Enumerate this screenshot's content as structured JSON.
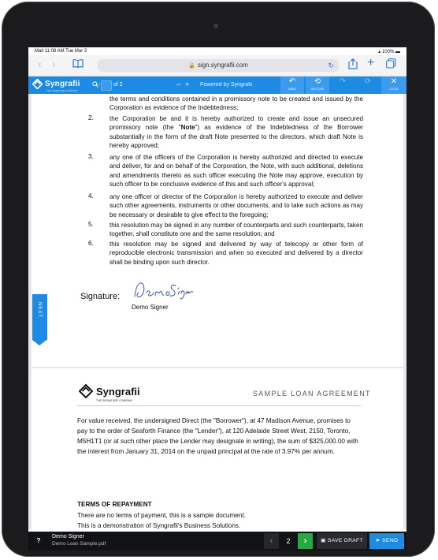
{
  "status_bar": {
    "left": "Mail  11:08 AM  Tue Mar 3",
    "right": "100%"
  },
  "browser": {
    "url": "sign.syngrafii.com"
  },
  "app_toolbar": {
    "brand": "Syngrafii",
    "brand_sub": "THE SIGNATURE COMPANY",
    "zoom_out": "−",
    "zoom_in": "+",
    "page_of": "of 2",
    "powered_by": "Powered by Syngrafii",
    "tools": [
      {
        "label": "UNDO"
      },
      {
        "label": "RESTORE"
      },
      {
        "label": ""
      },
      {
        "label": ""
      },
      {
        "label": "CLOSE"
      }
    ]
  },
  "page1": {
    "intro": "the terms and conditions contained in a promissory note to be created and issued by the Corporation as evidence of the Indebtedness;",
    "items": [
      {
        "num": "2.",
        "text": "the Corporation be and it is hereby authorized to create and issue an unsecured promissory note (the \"Note\") as evidence of the Indebtedness of the Borrower substantially in the form of the draft Note presented to the directors, which draft Note is hereby approved;"
      },
      {
        "num": "3.",
        "text": "any one of the officers of the Corporation is hereby authorized and directed to execute and deliver, for and on behalf of the Corporation, the Note, with such additional, deletions and amendments thereto as such officer executing the Note may approve, execution by such officer to be conclusive evidence of this and such officer's approval;"
      },
      {
        "num": "4.",
        "text": "any one officer or director of the Corporation is hereby authorized to execute and deliver such other agreements, instruments or other documents, and to take such actions as may be necessary or desirable to give effect to the foregoing;"
      },
      {
        "num": "5.",
        "text": "this resolution may be signed in any number of counterparts and such counterparts, taken together, shall constitute one and the same resolution; and"
      },
      {
        "num": "6.",
        "text": "this resolution may be signed and delivered by way of telecopy or other form of reproducible electronic transmission and when so executed and delivered by a director shall be binding upon such director."
      }
    ],
    "signature_label": "Signature:",
    "signature_script": "Demo Signer",
    "signer_name": "Demo Signer",
    "next_tab": "NEXT"
  },
  "page2": {
    "logo": "Syngrafii",
    "logo_sub": "THE SIGNATURE COMPANY",
    "title": "SAMPLE LOAN AGREEMENT",
    "paragraph": "For value received, the undersigned Direct (the \"Borrower\"), at 47 Madison Avenue, promises to pay to the order of Seaforth Finance (the \"Lender\"), at 120 Adelaide Street West, 2150, Toronto, M5H1T1 (or at such other place the Lender may designate in writing), the sum of $325,000.00 with the interest from January 31, 2014 on the unpaid principal at the rate of 3.97% per annum.",
    "heading": "TERMS OF REPAYMENT",
    "line1": "There are no terms of payment, this is a sample document.",
    "line2": "This is a demonstration of Syngrafii's Business Solutions."
  },
  "bottom_bar": {
    "help": "?",
    "signer": "Demo Signer",
    "file": "Demo Loan Sample.pdf",
    "prev": "‹",
    "page": "2",
    "next": "›",
    "save_draft": "SAVE DRAFT",
    "send": "SEND"
  },
  "colors": {
    "brand_blue": "#1d8be3",
    "next_green": "#27a844",
    "bar_dark": "#111214"
  }
}
